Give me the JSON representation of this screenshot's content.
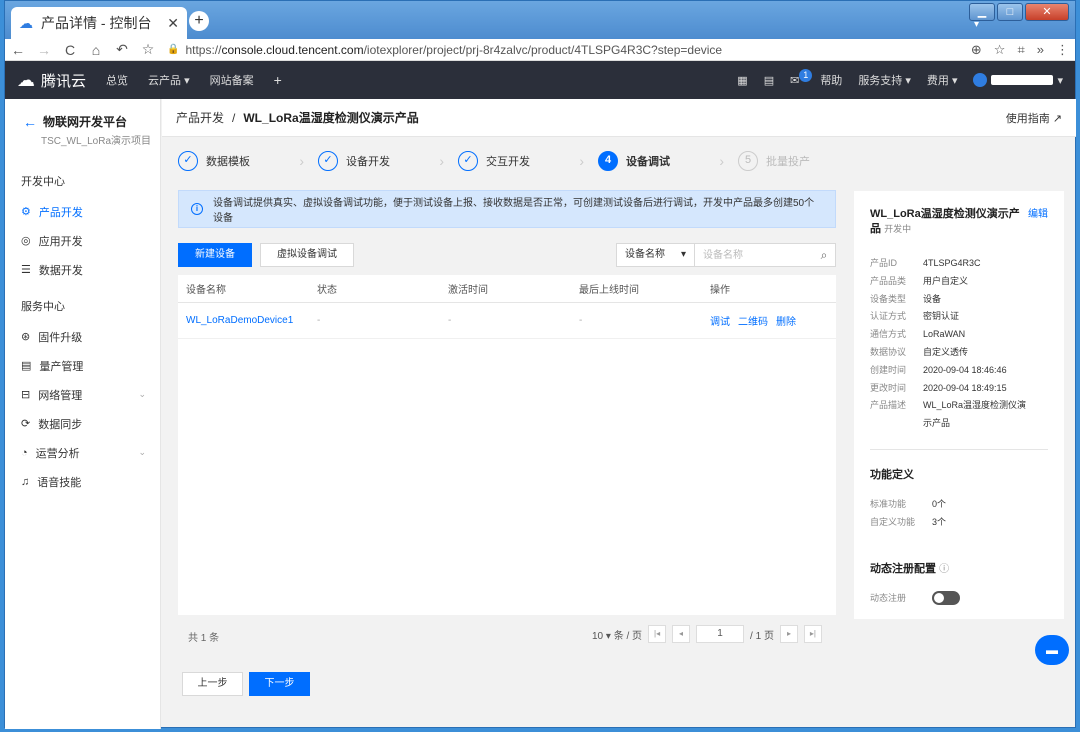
{
  "browser": {
    "tab_title": "产品详情 - 控制台",
    "new_tab": "+",
    "url_host": "console.cloud.tencent.com",
    "url_prefix": "https://",
    "url_path": "/iotexplorer/project/prj-8r4zalvc/product/4TLSPG4R3C?step=device"
  },
  "topnav": {
    "brand": "腾讯云",
    "items": [
      "总览",
      "云产品 ▾",
      "网站备案",
      "+"
    ],
    "right": {
      "help": "帮助",
      "mail_badge": "1",
      "support": "服务支持 ▾",
      "billing": "费用 ▾"
    }
  },
  "sidebar": {
    "platform": "物联网开发平台",
    "project": "TSC_WL_LoRa演示项目",
    "dev_center": "开发中心",
    "dev_items": [
      {
        "label": "产品开发",
        "icon": "gear-icon"
      },
      {
        "label": "应用开发",
        "icon": "app-icon"
      },
      {
        "label": "数据开发",
        "icon": "data-icon"
      }
    ],
    "service_center": "服务中心",
    "service_items": [
      {
        "label": "固件升级"
      },
      {
        "label": "量产管理"
      },
      {
        "label": "网络管理"
      },
      {
        "label": "数据同步"
      },
      {
        "label": "运营分析"
      },
      {
        "label": "语音技能"
      }
    ]
  },
  "breadcrumb": {
    "parent": "产品开发",
    "sep": "/",
    "current": "WL_LoRa温湿度检测仪演示产品",
    "guide": "使用指南"
  },
  "steps": [
    {
      "num": "✓",
      "label": "数据模板"
    },
    {
      "num": "✓",
      "label": "设备开发"
    },
    {
      "num": "✓",
      "label": "交互开发"
    },
    {
      "num": "4",
      "label": "设备调试"
    },
    {
      "num": "5",
      "label": "批量投产"
    }
  ],
  "info_banner": "设备调试提供真实、虚拟设备调试功能，便于测试设备上报、接收数据是否正常，可创建测试设备后进行调试，开发中产品最多创建50个设备",
  "toolbar": {
    "new_device": "新建设备",
    "virtual_debug": "虚拟设备调试",
    "search_field": "设备名称",
    "search_placeholder": "设备名称"
  },
  "table": {
    "headers": [
      "设备名称",
      "状态",
      "激活时间",
      "最后上线时间",
      "操作"
    ],
    "rows": [
      {
        "name": "WL_LoRaDemoDevice1",
        "status": "-",
        "activated": "-",
        "last_online": "-",
        "ops": [
          "调试",
          "二维码",
          "删除"
        ]
      }
    ]
  },
  "pagination": {
    "total": "共 1 条",
    "page_size": "10 ▾ 条 / 页",
    "page": "1",
    "pages": "/ 1 页"
  },
  "nav_buttons": {
    "prev": "上一步",
    "next": "下一步"
  },
  "product_panel": {
    "title": "WL_LoRa温湿度检测仪演示产品",
    "status": "开发中",
    "edit": "编辑",
    "fields": [
      {
        "k": "产品ID",
        "v": "4TLSPG4R3C"
      },
      {
        "k": "产品品类",
        "v": "用户自定义"
      },
      {
        "k": "设备类型",
        "v": "设备"
      },
      {
        "k": "认证方式",
        "v": "密钥认证"
      },
      {
        "k": "通信方式",
        "v": "LoRaWAN"
      },
      {
        "k": "数据协议",
        "v": "自定义透传"
      },
      {
        "k": "创建时间",
        "v": "2020-09-04 18:46:46"
      },
      {
        "k": "更改时间",
        "v": "2020-09-04 18:49:15"
      },
      {
        "k": "产品描述",
        "v": "WL_LoRa温湿度检测仪演示产品"
      }
    ],
    "func_title": "功能定义",
    "func": [
      {
        "k": "标准功能",
        "v": "0个"
      },
      {
        "k": "自定义功能",
        "v": "3个"
      }
    ],
    "reg_title": "动态注册配置",
    "reg_label": "动态注册"
  },
  "colors": {
    "accent": "#006eff",
    "topnav_bg": "#2b2f3a",
    "banner_bg": "#d5e7fd"
  }
}
